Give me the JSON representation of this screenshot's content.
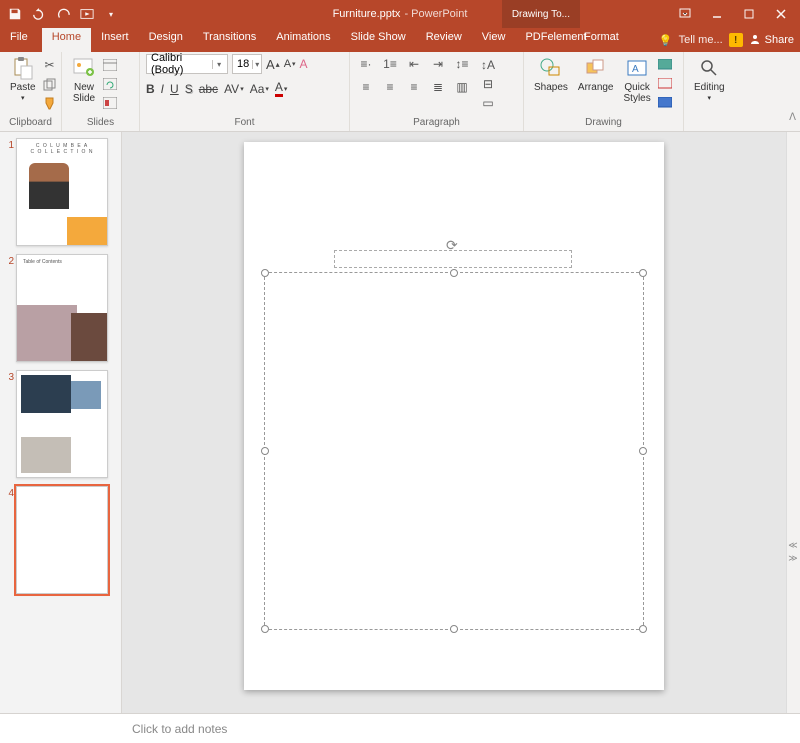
{
  "titlebar": {
    "filename": "Furniture.pptx",
    "app_suffix": "- PowerPoint",
    "drawing_tools": "Drawing To..."
  },
  "tabs": {
    "file": "File",
    "home": "Home",
    "insert": "Insert",
    "design": "Design",
    "transitions": "Transitions",
    "animations": "Animations",
    "slideshow": "Slide Show",
    "review": "Review",
    "view": "View",
    "pdfelement": "PDFelement",
    "format": "Format",
    "tell_me": "Tell me...",
    "share": "Share"
  },
  "ribbon": {
    "clipboard": {
      "label": "Clipboard",
      "paste": "Paste"
    },
    "slides": {
      "label": "Slides",
      "new_slide": "New\nSlide"
    },
    "font": {
      "label": "Font",
      "name": "Calibri (Body)",
      "size": "18"
    },
    "paragraph": {
      "label": "Paragraph"
    },
    "drawing": {
      "label": "Drawing",
      "shapes": "Shapes",
      "arrange": "Arrange",
      "quick_styles": "Quick\nStyles"
    },
    "editing": {
      "label": "Editing",
      "btn": "Editing"
    }
  },
  "thumbs": {
    "n1": "1",
    "n2": "2",
    "n3": "3",
    "n4": "4",
    "th1_title": "C O L U M B E A",
    "th1_sub": "C O L L E C T I O N",
    "th2_title": "Table of Contents"
  },
  "notes": {
    "placeholder": "Click to add notes"
  }
}
